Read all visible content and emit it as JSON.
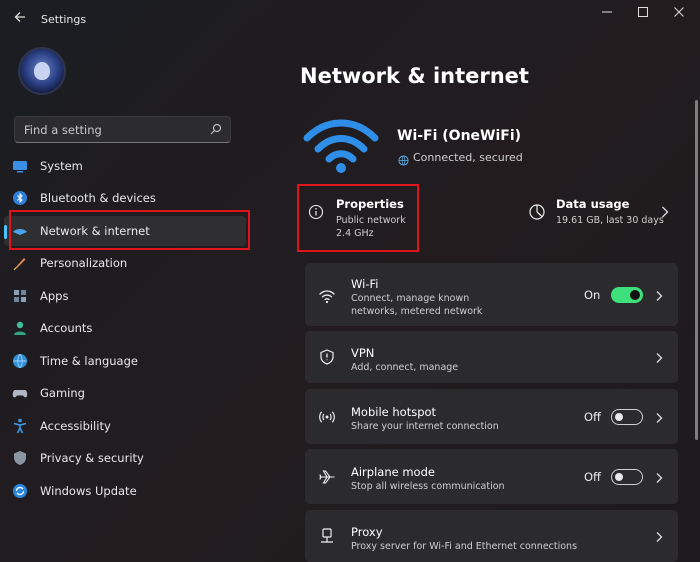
{
  "window": {
    "title": "Settings"
  },
  "search": {
    "placeholder": "Find a setting"
  },
  "sidebar": {
    "items": [
      {
        "label": "System",
        "icon": "system-icon"
      },
      {
        "label": "Bluetooth & devices",
        "icon": "bluetooth-icon"
      },
      {
        "label": "Network & internet",
        "icon": "network-icon",
        "active": true
      },
      {
        "label": "Personalization",
        "icon": "brush-icon"
      },
      {
        "label": "Apps",
        "icon": "apps-icon"
      },
      {
        "label": "Accounts",
        "icon": "accounts-icon"
      },
      {
        "label": "Time & language",
        "icon": "time-language-icon"
      },
      {
        "label": "Gaming",
        "icon": "gaming-icon"
      },
      {
        "label": "Accessibility",
        "icon": "accessibility-icon"
      },
      {
        "label": "Privacy & security",
        "icon": "shield-icon"
      },
      {
        "label": "Windows Update",
        "icon": "update-icon"
      }
    ]
  },
  "main": {
    "title": "Network & internet",
    "network": {
      "name": "Wi-Fi (OneWiFi)",
      "status": "Connected, secured"
    },
    "properties": {
      "title": "Properties",
      "line1": "Public network",
      "line2": "2.4 GHz"
    },
    "data_usage": {
      "title": "Data usage",
      "detail": "19.61 GB, last 30 days"
    },
    "cards": [
      {
        "title": "Wi-Fi",
        "sub1": "Connect, manage known",
        "sub2": "networks, metered network",
        "state": "On",
        "toggle_on": true,
        "icon": "wifi-icon"
      },
      {
        "title": "VPN",
        "sub1": "Add, connect, manage",
        "icon": "vpn-shield-icon"
      },
      {
        "title": "Mobile hotspot",
        "sub1": "Share your internet connection",
        "state": "Off",
        "toggle_on": false,
        "icon": "hotspot-icon"
      },
      {
        "title": "Airplane mode",
        "sub1": "Stop all wireless communication",
        "state": "Off",
        "toggle_on": false,
        "icon": "airplane-icon"
      },
      {
        "title": "Proxy",
        "sub1": "Proxy server for Wi-Fi and Ethernet connections",
        "icon": "proxy-icon"
      }
    ]
  },
  "colors": {
    "accent": "#4cc2ff",
    "toggle_on": "#3ee07b",
    "highlight_box": "#e0141b"
  }
}
